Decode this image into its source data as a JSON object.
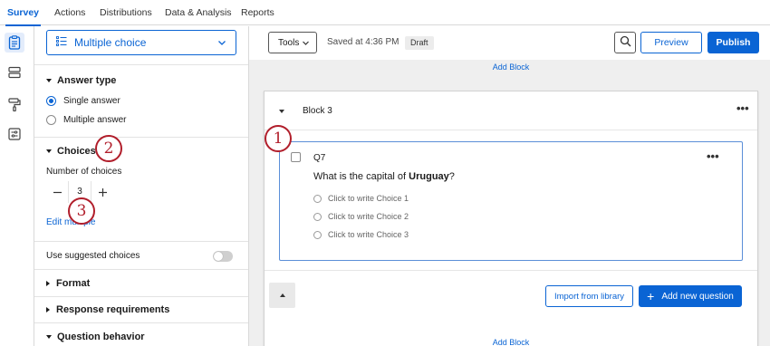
{
  "nav": {
    "tabs": [
      {
        "label": "Survey",
        "active": true
      },
      {
        "label": "Actions"
      },
      {
        "label": "Distributions"
      },
      {
        "label": "Data & Analysis"
      },
      {
        "label": "Reports"
      }
    ]
  },
  "rail": {
    "icons": [
      "survey-icon",
      "blocks-icon",
      "paint-roller-icon",
      "settings-sliders-icon"
    ]
  },
  "panel": {
    "question_type": "Multiple choice",
    "answer_type": {
      "title": "Answer type",
      "options": [
        {
          "label": "Single answer",
          "selected": true
        },
        {
          "label": "Multiple answer",
          "selected": false
        }
      ]
    },
    "choices": {
      "title": "Choices",
      "number_label": "Number of choices",
      "count": "3",
      "edit_multiple": "Edit multiple"
    },
    "use_suggested": {
      "label": "Use suggested choices",
      "enabled": false
    },
    "sections": [
      "Format",
      "Response requirements",
      "Question behavior"
    ]
  },
  "toolbar": {
    "tools_label": "Tools",
    "saved_text": "Saved at 4:36 PM",
    "draft_badge": "Draft",
    "preview_label": "Preview",
    "publish_label": "Publish"
  },
  "editor": {
    "add_block_label": "Add Block",
    "block_title": "Block 3",
    "question": {
      "number": "Q7",
      "text_before": "What is the capital of ",
      "text_bold": "Uruguay",
      "text_after": "?",
      "choices": [
        "Click to write Choice 1",
        "Click to write Choice 2",
        "Click to write Choice 3"
      ]
    },
    "import_label": "Import from library",
    "add_question_label": "Add new question"
  },
  "badges": [
    "1",
    "2",
    "3"
  ],
  "colors": {
    "accent": "#0a64d4",
    "badge": "#b11e2b"
  }
}
